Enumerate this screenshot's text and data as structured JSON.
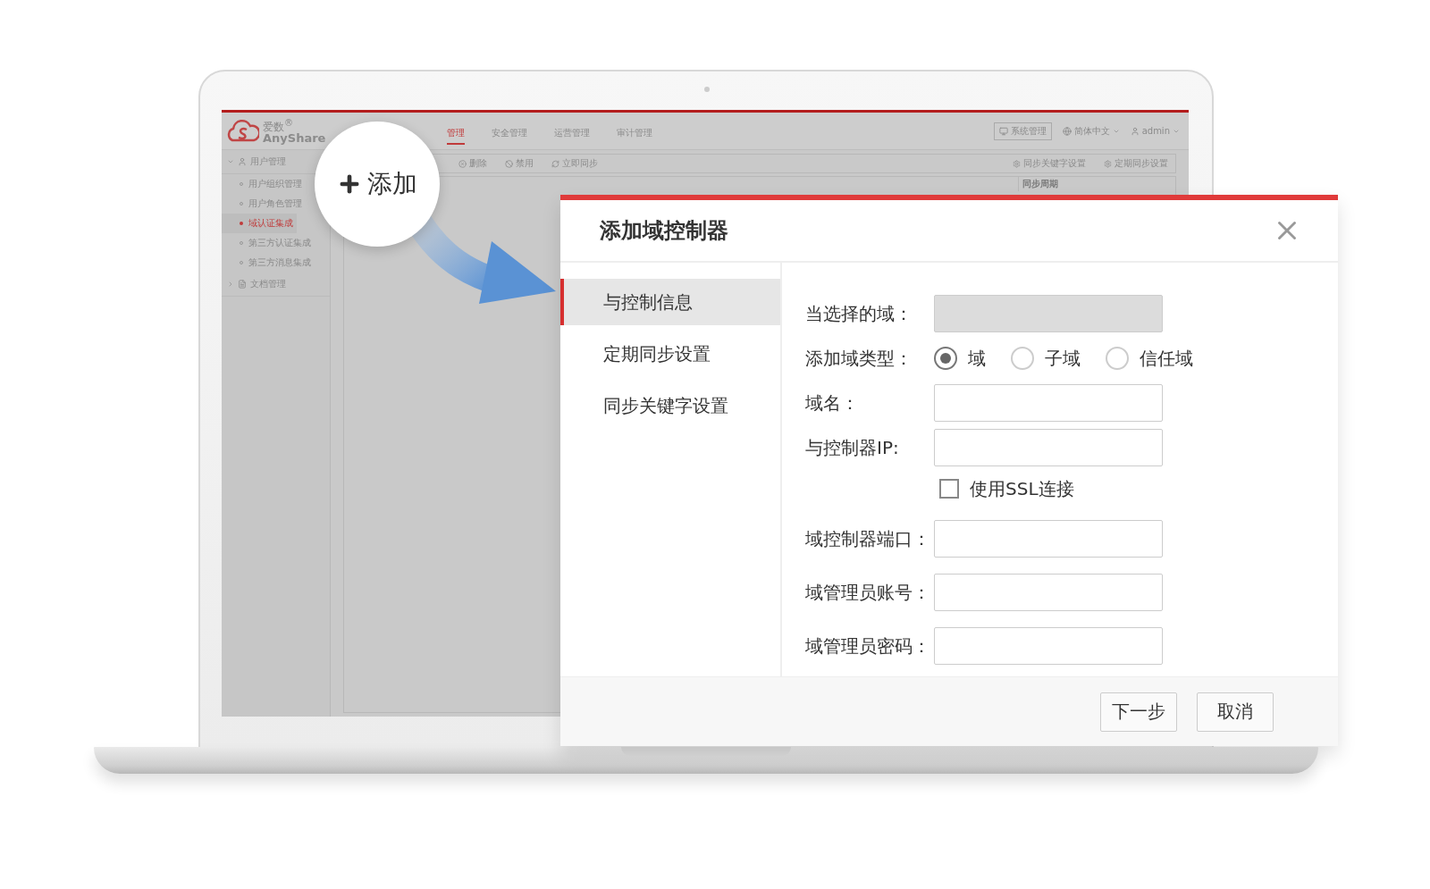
{
  "screen": {
    "logo": {
      "name": "爱数$^{®}$",
      "brand": "AnyShare"
    },
    "nav_tabs": [
      {
        "label": "管理",
        "selected": true
      },
      {
        "label": "安全管理",
        "selected": false
      },
      {
        "label": "运营管理",
        "selected": false
      },
      {
        "label": "审计管理",
        "selected": false
      }
    ],
    "header_actions": [
      {
        "kind": "button",
        "label": "系统管理"
      },
      {
        "kind": "language",
        "label": "简体中文"
      },
      {
        "kind": "user",
        "label": "admin"
      }
    ],
    "sidebar": [
      {
        "label": "用户管理",
        "expanded": true,
        "children": [
          {
            "label": "用户组织管理",
            "selected": false
          },
          {
            "label": "用户角色管理",
            "selected": false
          },
          {
            "label": "域认证集成",
            "selected": true
          },
          {
            "label": "第三方认证集成",
            "selected": false
          },
          {
            "label": "第三方消息集成",
            "selected": false
          }
        ]
      },
      {
        "label": "文档管理",
        "expanded": false
      }
    ],
    "toolbar": [
      {
        "kind": "delete",
        "label": "删除"
      },
      {
        "kind": "disable",
        "label": "禁用"
      },
      {
        "kind": "sync",
        "label": "立即同步"
      }
    ],
    "toolbar_right": [
      "同步关键字设置",
      "定期同步设置"
    ],
    "table": {
      "columns": [
        "同步周期"
      ]
    }
  },
  "callout": {
    "label": "添加"
  },
  "dialog": {
    "title": "添加域控制器",
    "nav": [
      {
        "label": "与控制信息",
        "selected": true
      },
      {
        "label": "定期同步设置",
        "selected": false
      },
      {
        "label": "同步关键字设置",
        "selected": false
      }
    ],
    "fields": [
      {
        "kind": "display",
        "label": "当选择的域：",
        "disabled": true
      },
      {
        "kind": "radio",
        "label": "添加域类型：",
        "options": [
          {
            "label": "域",
            "selected": true
          },
          {
            "label": "子域",
            "selected": false
          },
          {
            "label": "信任域",
            "selected": false
          }
        ]
      },
      {
        "kind": "text",
        "label": "域名：",
        "disabled": false
      },
      {
        "kind": "text",
        "label": "与控制器IP:",
        "disabled": false
      },
      {
        "kind": "checkbox",
        "label": "使用SSL连接",
        "checked": false
      },
      {
        "kind": "text",
        "label": "域控制器端口：",
        "disabled": false
      },
      {
        "kind": "text",
        "label": "域管理员账号：",
        "disabled": false
      },
      {
        "kind": "text",
        "label": "域管理员密码：",
        "disabled": false
      }
    ],
    "buttons": [
      "下一步",
      "取消"
    ]
  }
}
